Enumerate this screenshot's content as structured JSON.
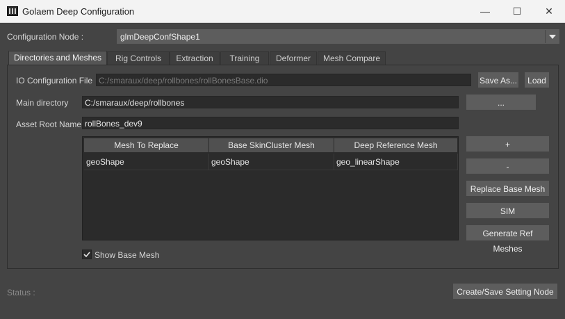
{
  "window": {
    "title": "Golaem Deep Configuration",
    "minimize": "—",
    "maximize": "☐",
    "close": "✕"
  },
  "config_node": {
    "label": "Configuration Node :",
    "value": "glmDeepConfShape1"
  },
  "tabs": [
    {
      "label": "Directories and Meshes",
      "active": true
    },
    {
      "label": "Rig Controls"
    },
    {
      "label": "Extraction"
    },
    {
      "label": "Training"
    },
    {
      "label": "Deformer"
    },
    {
      "label": "Mesh Compare"
    }
  ],
  "io_config": {
    "label": "IO Configuration File",
    "value": "C:/smaraux/deep/rollbones/rollBonesBase.dio",
    "save_as": "Save As...",
    "load": "Load"
  },
  "main_dir": {
    "label": "Main directory",
    "value": "C:/smaraux/deep/rollbones",
    "browse": "..."
  },
  "asset_root": {
    "label": "Asset Root Name",
    "value": "rollBones_dev9"
  },
  "mesh_table": {
    "headers": [
      "Mesh To Replace",
      "Base SkinCluster Mesh",
      "Deep Reference Mesh"
    ],
    "rows": [
      [
        "geoShape",
        "geoShape",
        "geo_linearShape"
      ]
    ]
  },
  "side_buttons": {
    "add": "+",
    "remove": "-",
    "replace": "Replace Base Mesh",
    "sim": "SIM",
    "generate": "Generate Ref Meshes"
  },
  "show_base_mesh": {
    "label": "Show Base Mesh",
    "checked": true
  },
  "status": {
    "label": "Status :"
  },
  "create_save": "Create/Save Setting Node"
}
